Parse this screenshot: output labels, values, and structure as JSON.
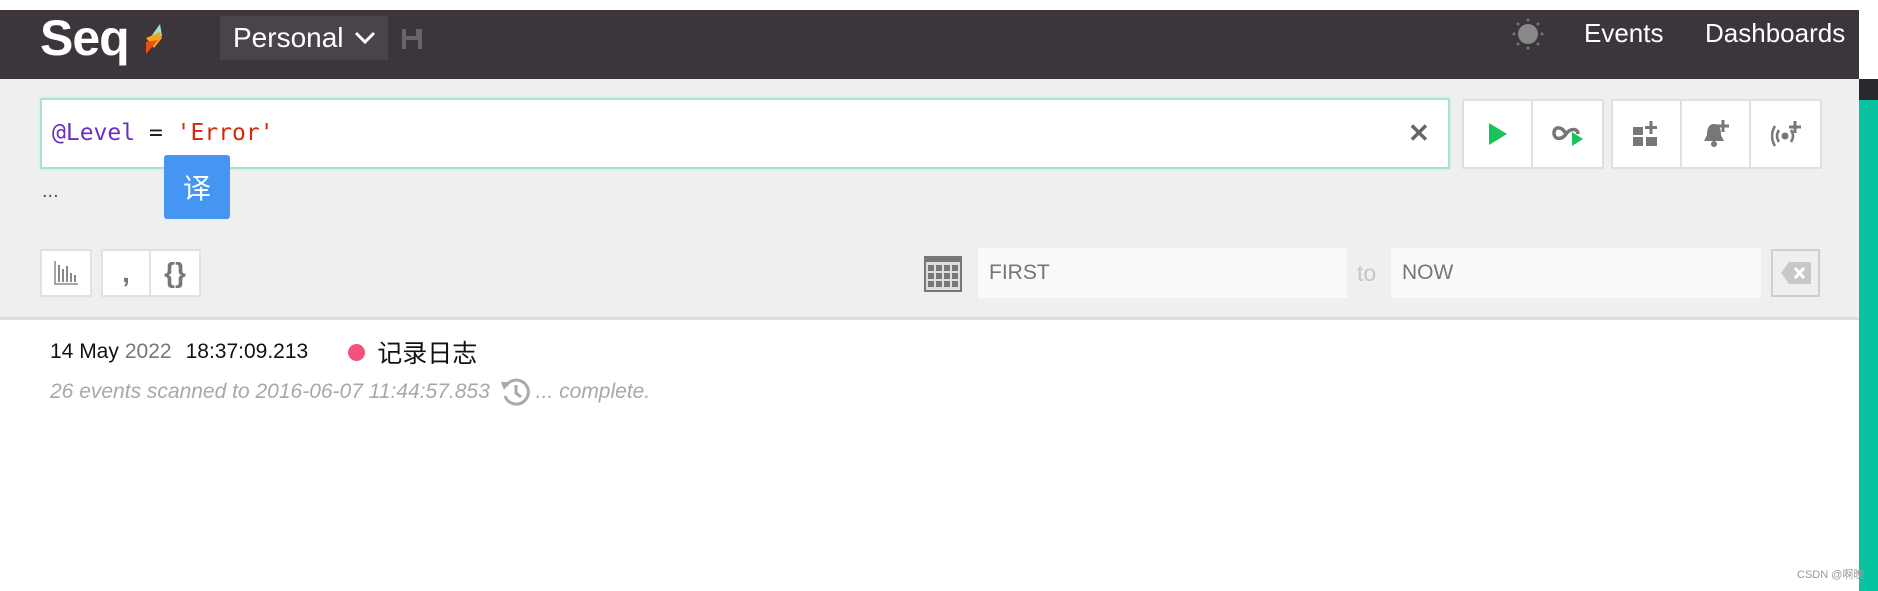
{
  "header": {
    "logo": "Seq",
    "workspace": "Personal",
    "nav": [
      {
        "label": "Events"
      },
      {
        "label": "Dashboards"
      }
    ]
  },
  "query": {
    "keyword": "@Level",
    "operator": "=",
    "value": "'Error'",
    "translate_popup": "译",
    "ellipsis": "..."
  },
  "range": {
    "from_placeholder": "FIRST",
    "to_label": "to",
    "to_placeholder": "NOW"
  },
  "events": [
    {
      "day": "14 May",
      "year": "2022",
      "time": "18:37:09.213",
      "level_color": "#f4527e",
      "message": "记录日志"
    }
  ],
  "status": {
    "scanned": "26 events scanned to 2016-06-07 11:44:57.853",
    "complete": "... complete."
  },
  "watermark": "CSDN @啊晚",
  "colors": {
    "accent": "#07c3a0",
    "header": "#3c363c",
    "run": "#19c25a",
    "translate": "#4596f3"
  }
}
